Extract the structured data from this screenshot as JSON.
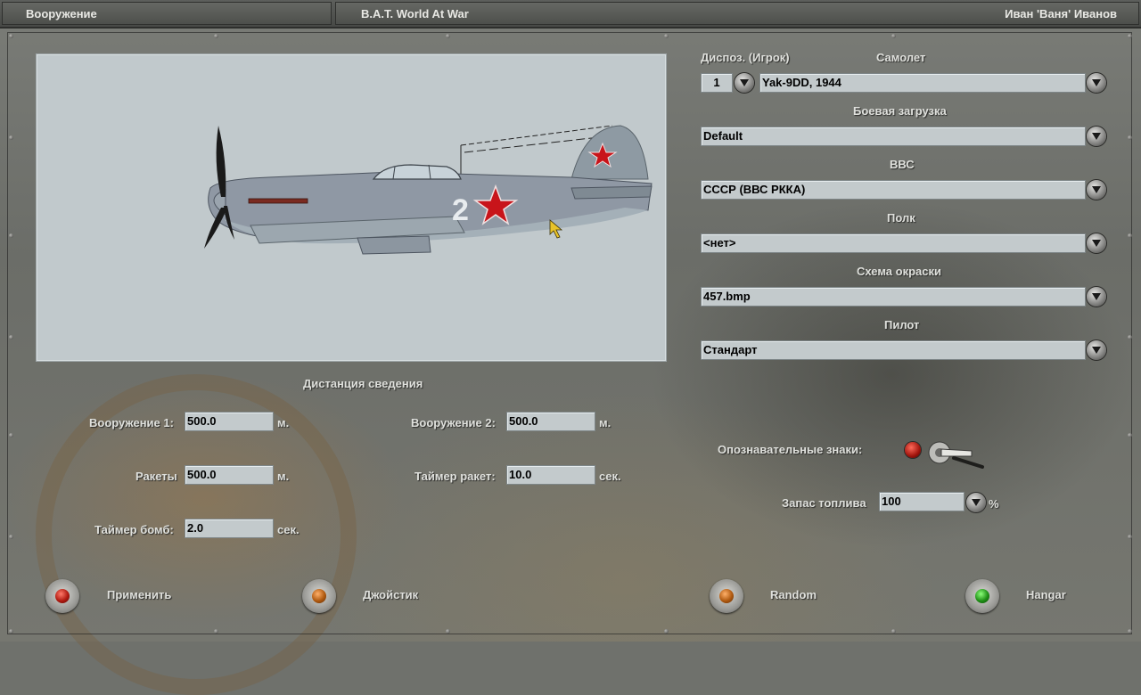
{
  "window": {
    "section_title": "Вооружение",
    "app_title": "B.A.T. World At War",
    "user_name": "Иван 'Ваня' Иванов"
  },
  "preview": {
    "tail_number": "2"
  },
  "right_panel": {
    "disposition_label": "Диспоз. (Игрок)",
    "disposition_value": "1",
    "aircraft_label": "Самолет",
    "aircraft_value": "Yak-9DD, 1944",
    "loadout_label": "Боевая загрузка",
    "loadout_value": "Default",
    "air_force_label": "ВВС",
    "air_force_value": "СССР (ВВС РККА)",
    "regiment_label": "Полк",
    "regiment_value": "<нет>",
    "skin_label": "Схема окраски",
    "skin_value": "457.bmp",
    "pilot_label": "Пилот",
    "pilot_value": "Стандарт",
    "markings_label": "Опознавательные знаки:",
    "fuel_label": "Запас топлива",
    "fuel_value": "100",
    "fuel_unit": "%"
  },
  "convergence": {
    "heading": "Дистанция сведения",
    "weapon1_label": "Вооружение 1:",
    "weapon1_value": "500.0",
    "weapon1_unit": "м.",
    "weapon2_label": "Вооружение 2:",
    "weapon2_value": "500.0",
    "weapon2_unit": "м.",
    "rockets_label": "Ракеты",
    "rockets_value": "500.0",
    "rockets_unit": "м.",
    "rocket_timer_label": "Таймер ракет:",
    "rocket_timer_value": "10.0",
    "rocket_timer_unit": "сек.",
    "bomb_timer_label": "Таймер бомб:",
    "bomb_timer_value": "2.0",
    "bomb_timer_unit": "сек."
  },
  "buttons": {
    "apply": "Применить",
    "joystick": "Джойстик",
    "random": "Random",
    "hangar": "Hangar"
  },
  "colors": {
    "field_bg": "#c3cacc",
    "preview_bg": "#c1c9cc",
    "label": "#dfe0dc",
    "lamp_red": "#b01a10",
    "lamp_orange": "#b05a10",
    "lamp_green": "#1f8f16"
  }
}
